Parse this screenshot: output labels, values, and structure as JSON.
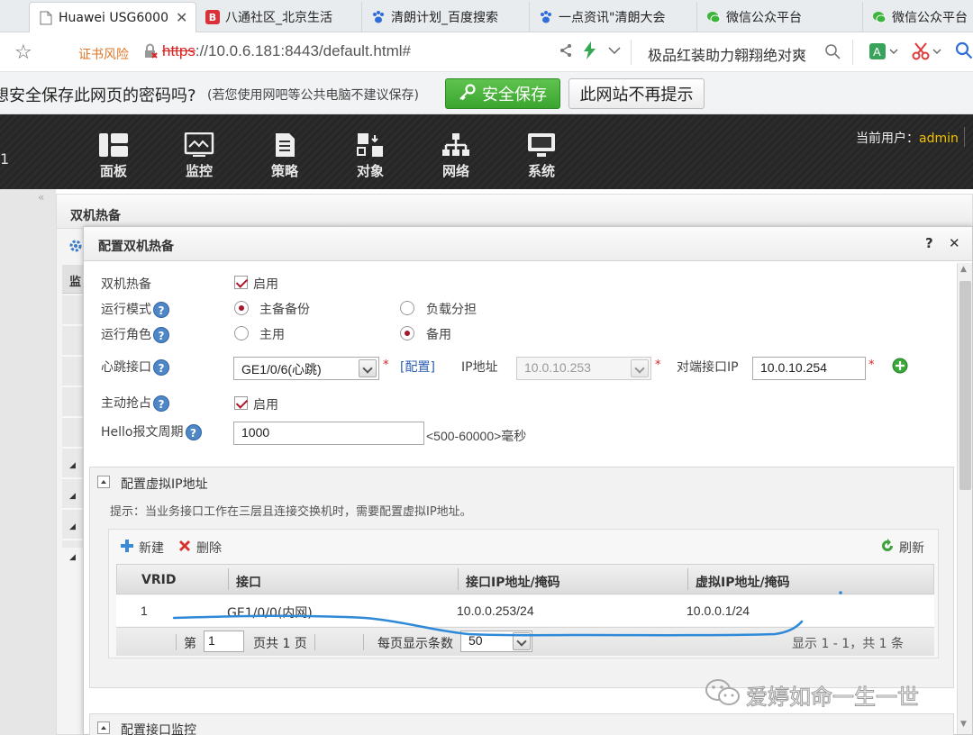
{
  "browser": {
    "tabs": [
      {
        "label": "Huawei USG6000",
        "icon": "page-icon",
        "active": true
      },
      {
        "label": "八通社区_北京生活",
        "icon": "b-logo-icon",
        "color": "#d9313a"
      },
      {
        "label": "清朗计划_百度搜索",
        "icon": "baidu-paw-icon",
        "color": "#2f6ed8"
      },
      {
        "label": "一点资讯\"清朗大会",
        "icon": "baidu-paw-icon",
        "color": "#2f6ed8"
      },
      {
        "label": "微信公众平台",
        "icon": "wechat-icon",
        "color": "#3db43b"
      },
      {
        "label": "微信公众平台",
        "icon": "wechat-icon",
        "color": "#3db43b"
      }
    ],
    "cert_warning": "证书风险",
    "url_scheme": "https",
    "url_rest": "://10.0.6.181:8443/default.html#",
    "search_text": "极品红装助力翱翔绝对爽"
  },
  "password_bar": {
    "question": "想安全保存此网页的密码吗?",
    "note": "(若您使用网吧等公共电脑不建议保存)",
    "save_label": "安全保存",
    "never_label": "此网站不再提示"
  },
  "topnav": {
    "left_stub": "1",
    "items": [
      {
        "label": "面板",
        "icon": "dashboard-icon"
      },
      {
        "label": "监控",
        "icon": "monitor-icon"
      },
      {
        "label": "策略",
        "icon": "policy-icon"
      },
      {
        "label": "对象",
        "icon": "object-icon"
      },
      {
        "label": "网络",
        "icon": "network-icon"
      },
      {
        "label": "系统",
        "icon": "system-icon"
      }
    ],
    "current_user_label": "当前用户：",
    "current_user": "admin"
  },
  "panel": {
    "title": "双机热备",
    "side_label": "监"
  },
  "dialog": {
    "title": "配置双机热备",
    "help": "?",
    "close": "✕",
    "hot_standby_label": "双机热备",
    "enable_text": "启用",
    "run_mode_label": "运行模式",
    "run_mode_opts": [
      "主备备份",
      "负载分担"
    ],
    "run_mode_selected": "主备备份",
    "run_role_label": "运行角色",
    "run_role_opts": [
      "主用",
      "备用"
    ],
    "run_role_selected": "备用",
    "heartbeat_label": "心跳接口",
    "heartbeat_value": "GE1/0/6(心跳)",
    "config_link": "[配置]",
    "ip_label": "IP地址",
    "ip_value": "10.0.10.253",
    "peer_ip_label": "对端接口IP",
    "peer_ip_value": "10.0.10.254",
    "preempt_label": "主动抢占",
    "preempt_enable": "启用",
    "hello_label": "Hello报文周期",
    "hello_value": "1000",
    "hello_range": "<500-60000>毫秒",
    "vip_section": {
      "title": "配置虚拟IP地址",
      "hint": "提示：当业务接口工作在三层且连接交换机时，需要配置虚拟IP地址。",
      "new_label": "新建",
      "delete_label": "删除",
      "refresh_label": "刷新",
      "columns": [
        "VRID",
        "接口",
        "接口IP地址/掩码",
        "虚拟IP地址/掩码"
      ],
      "rows": [
        [
          "1",
          "GE1/0/0(内网)",
          "10.0.0.253/24",
          "10.0.0.1/24"
        ]
      ],
      "pager": {
        "page_prefix": "第",
        "page": "1",
        "page_suffix": "页共 1 页",
        "per_page_label": "每页显示条数",
        "per_page": "50",
        "summary": "显示 1 - 1，共 1 条"
      }
    },
    "iface_section_title": "配置接口监控"
  },
  "watermark": "爱婷如命一生一世",
  "colors": {
    "accent_green": "#3fb23a",
    "required_red": "#d22222",
    "radio_red": "#a8162a",
    "link_blue": "#2a5db0",
    "admin_yellow": "#f2c200",
    "annotation_blue": "#2e8ad8"
  }
}
